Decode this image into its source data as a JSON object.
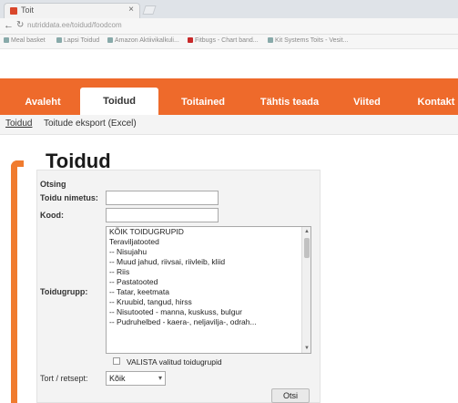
{
  "browser": {
    "tab_title": "Toit",
    "close_glyph": "×",
    "url": "nutriddata.ee/toidud/foodcom",
    "bookmarks": [
      "Meal basket",
      "Lapsi Toidud",
      "Amazon Aktiivikalkuli...",
      "Fitbugs - Chart band...",
      "Kit Systems Toits - Vesit..."
    ]
  },
  "nav": {
    "tabs": [
      {
        "label": "Avaleht"
      },
      {
        "label": "Toidud"
      },
      {
        "label": "Toitained"
      },
      {
        "label": "Tähtis teada"
      },
      {
        "label": "Viited"
      },
      {
        "label": "Kontakt"
      }
    ],
    "active_index": 1
  },
  "subnav": {
    "links": [
      "Toidud",
      "Toitude eksport (Excel)"
    ]
  },
  "page": {
    "title": "Toidud"
  },
  "search": {
    "heading": "Otsing",
    "name_label": "Toidu nimetus:",
    "name_value": "",
    "code_label": "Kood:",
    "code_value": "",
    "group_label": "Toidugrupp:",
    "groups": [
      "KÕIK TOIDUGRUPID",
      "Teraviljatooted",
      "-- Nisujahu",
      "-- Muud jahud, riivsai, riivleib, kliid",
      "-- Riis",
      "-- Pastatooted",
      "-- Tatar, keetmata",
      "-- Kruubid, tangud, hirss",
      "-- Nisutooted - manna, kuskuss, bulgur",
      "-- Pudruhelbed - kaera-, neljavilja-, odrah..."
    ],
    "checkbox_label": "VALISTA valitud toidugrupid",
    "sort_label": "Tort / retsept:",
    "sort_value": "Kõik",
    "submit_label": "Otsi"
  }
}
